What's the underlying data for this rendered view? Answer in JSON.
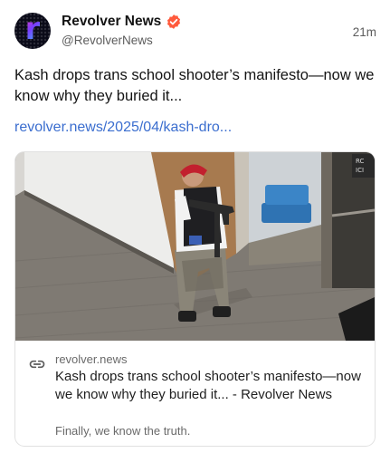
{
  "author": {
    "display_name": "Revolver News",
    "handle": "@RevolverNews",
    "avatar_letter": "r",
    "verified": true,
    "verified_color": "#ff5a3c"
  },
  "post": {
    "timestamp": "21m",
    "text": "Kash drops trans school shooter’s manifesto—now we know why they buried it...",
    "link_text": "revolver.news/2025/04/kash-dro..."
  },
  "link_card": {
    "domain": "revolver.news",
    "title": "Kash drops trans school shooter’s manifesto—now we know why they buried it... - Revolver News",
    "description": "Finally, we know the truth.",
    "image_sign_text": "RC\nICI"
  },
  "colors": {
    "link": "#3b6ecf",
    "muted": "#5c5c5c",
    "card_border": "#e1e1e1"
  }
}
